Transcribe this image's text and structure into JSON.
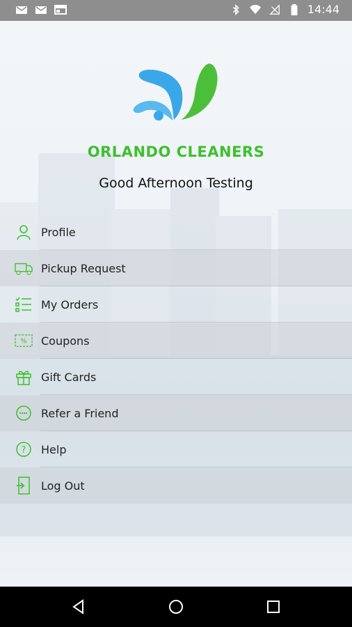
{
  "status_bar": {
    "time": "14:44"
  },
  "app": {
    "brand": "ORLANDO CLEANERS",
    "greeting": "Good Afternoon Testing"
  },
  "menu": [
    {
      "label": "Profile",
      "icon": "user-icon"
    },
    {
      "label": "Pickup Request",
      "icon": "truck-icon"
    },
    {
      "label": "My Orders",
      "icon": "list-icon"
    },
    {
      "label": "Coupons",
      "icon": "coupon-icon"
    },
    {
      "label": "Gift Cards",
      "icon": "gift-icon"
    },
    {
      "label": "Refer a Friend",
      "icon": "refer-icon"
    },
    {
      "label": "Help",
      "icon": "help-icon"
    },
    {
      "label": "Log Out",
      "icon": "logout-icon"
    }
  ],
  "colors": {
    "brand_green": "#3fbf2f",
    "brand_blue": "#3aa7e8"
  }
}
